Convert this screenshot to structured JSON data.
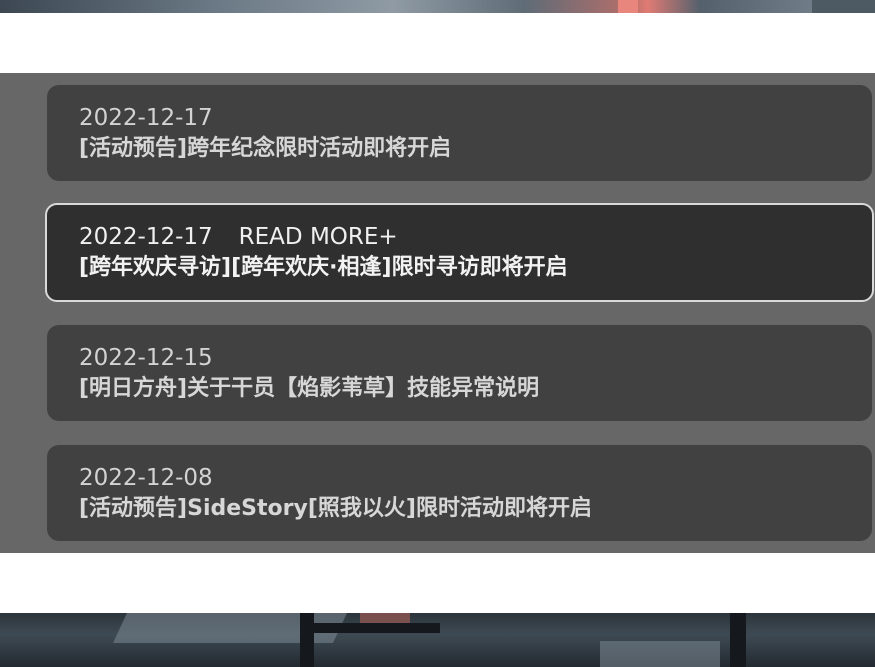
{
  "news": {
    "read_more_label": "READ MORE+",
    "items": [
      {
        "date": "2022-12-17",
        "title": "[活动预告]跨年纪念限时活动即将开启",
        "active": false
      },
      {
        "date": "2022-12-17",
        "title": "[跨年欢庆寻访][跨年欢庆·相逢]限时寻访即将开启",
        "active": true
      },
      {
        "date": "2022-12-15",
        "title": "[明日方舟]关于干员【焰影苇草】技能异常说明",
        "active": false
      },
      {
        "date": "2022-12-08",
        "title": "[活动预告]SideStory[照我以火]限时活动即将开启",
        "active": false
      }
    ]
  },
  "colors": {
    "panel_bg": "#676767",
    "item_bg": "#414141",
    "item_active_bg": "#2f2f2f",
    "active_border": "#d9d9d9"
  }
}
